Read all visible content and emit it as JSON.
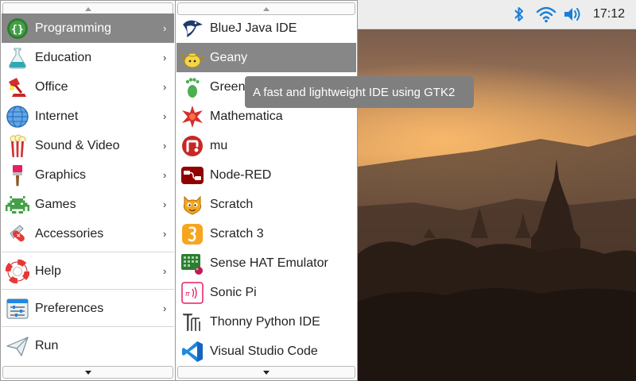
{
  "tray": {
    "clock": "17:12"
  },
  "main_menu": {
    "items": [
      {
        "label": "Programming"
      },
      {
        "label": "Education"
      },
      {
        "label": "Office"
      },
      {
        "label": "Internet"
      },
      {
        "label": "Sound & Video"
      },
      {
        "label": "Graphics"
      },
      {
        "label": "Games"
      },
      {
        "label": "Accessories"
      },
      {
        "label": "Help"
      },
      {
        "label": "Preferences"
      },
      {
        "label": "Run"
      }
    ],
    "submenu_arrow": "›"
  },
  "sub_menu": {
    "items": [
      {
        "label": "BlueJ Java IDE"
      },
      {
        "label": "Geany"
      },
      {
        "label": "Greenfoot"
      },
      {
        "label": "Mathematica"
      },
      {
        "label": "mu"
      },
      {
        "label": "Node-RED"
      },
      {
        "label": "Scratch"
      },
      {
        "label": "Scratch 3"
      },
      {
        "label": "Sense HAT Emulator"
      },
      {
        "label": "Sonic Pi"
      },
      {
        "label": "Thonny Python IDE"
      },
      {
        "label": "Visual Studio Code"
      }
    ]
  },
  "tooltip": {
    "text": "A fast and lightweight IDE using GTK2"
  },
  "colors": {
    "selection": "#878787",
    "bluetooth": "#1b7ed6",
    "wifi": "#1b7ed6",
    "volume": "#1b7ed6"
  }
}
